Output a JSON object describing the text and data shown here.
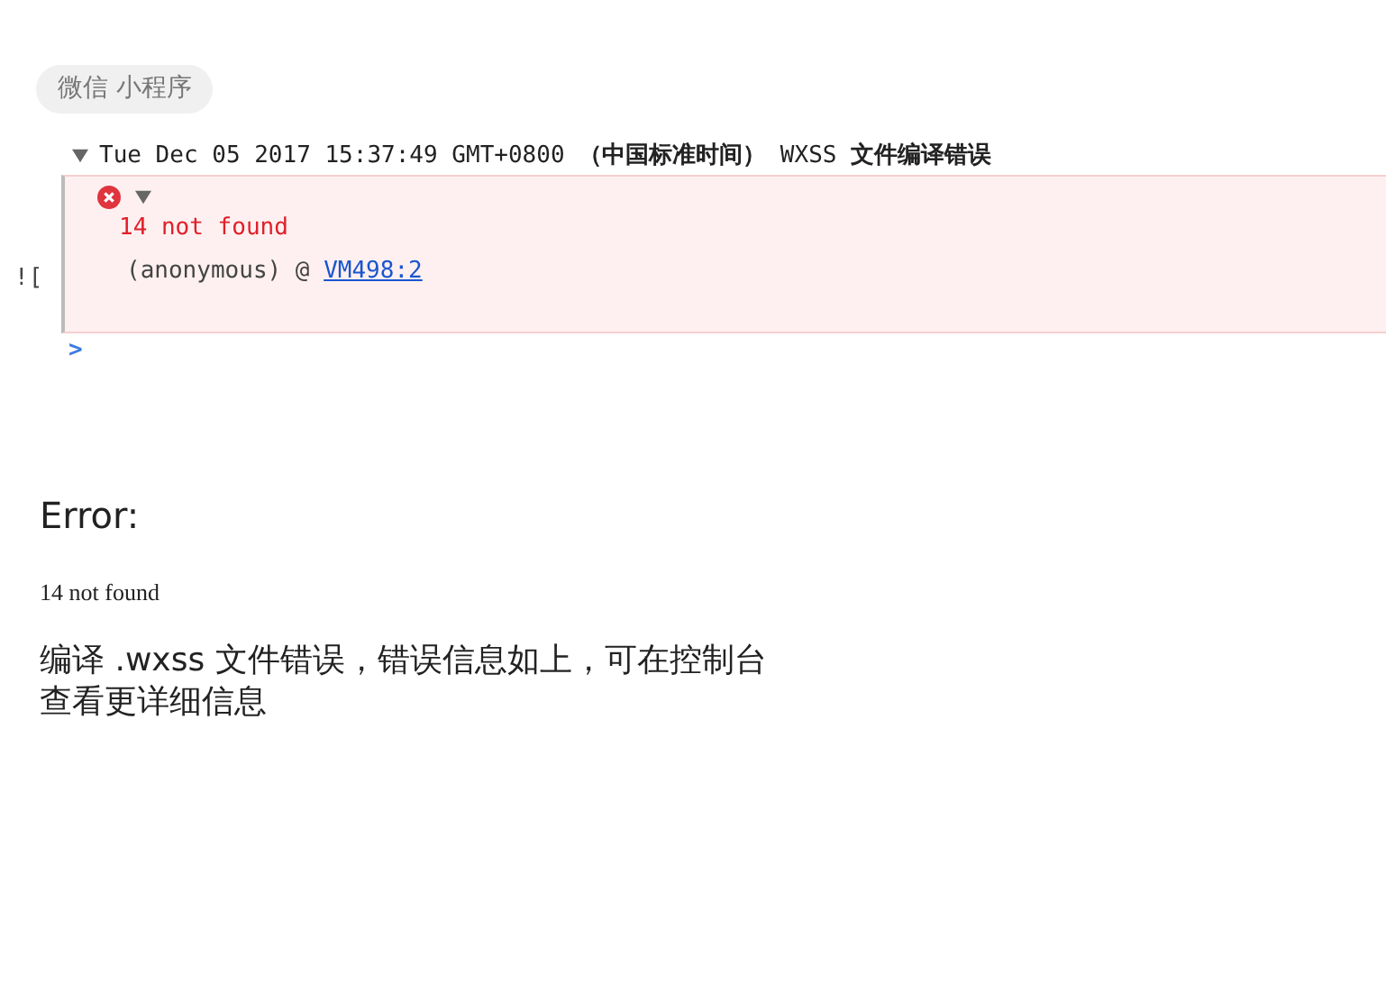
{
  "tag": "微信 小程序",
  "console": {
    "group": {
      "expanded": true,
      "title": "Tue Dec 05 2017 15:37:49 GMT+0800 **（中国标准时间）** WXSS **文件编译错误**"
    },
    "error": {
      "expanded": true,
      "message": "14 not found",
      "frame": "(anonymous) @ ",
      "link": "VM498:2"
    },
    "stray": "![",
    "prompt": ">"
  },
  "error_page": {
    "heading": "Error:",
    "code": "14 not found",
    "lines": [
      "编译 .wxss 文件错误，错误信息如上，可在控制台",
      "查看更详细信息"
    ]
  }
}
